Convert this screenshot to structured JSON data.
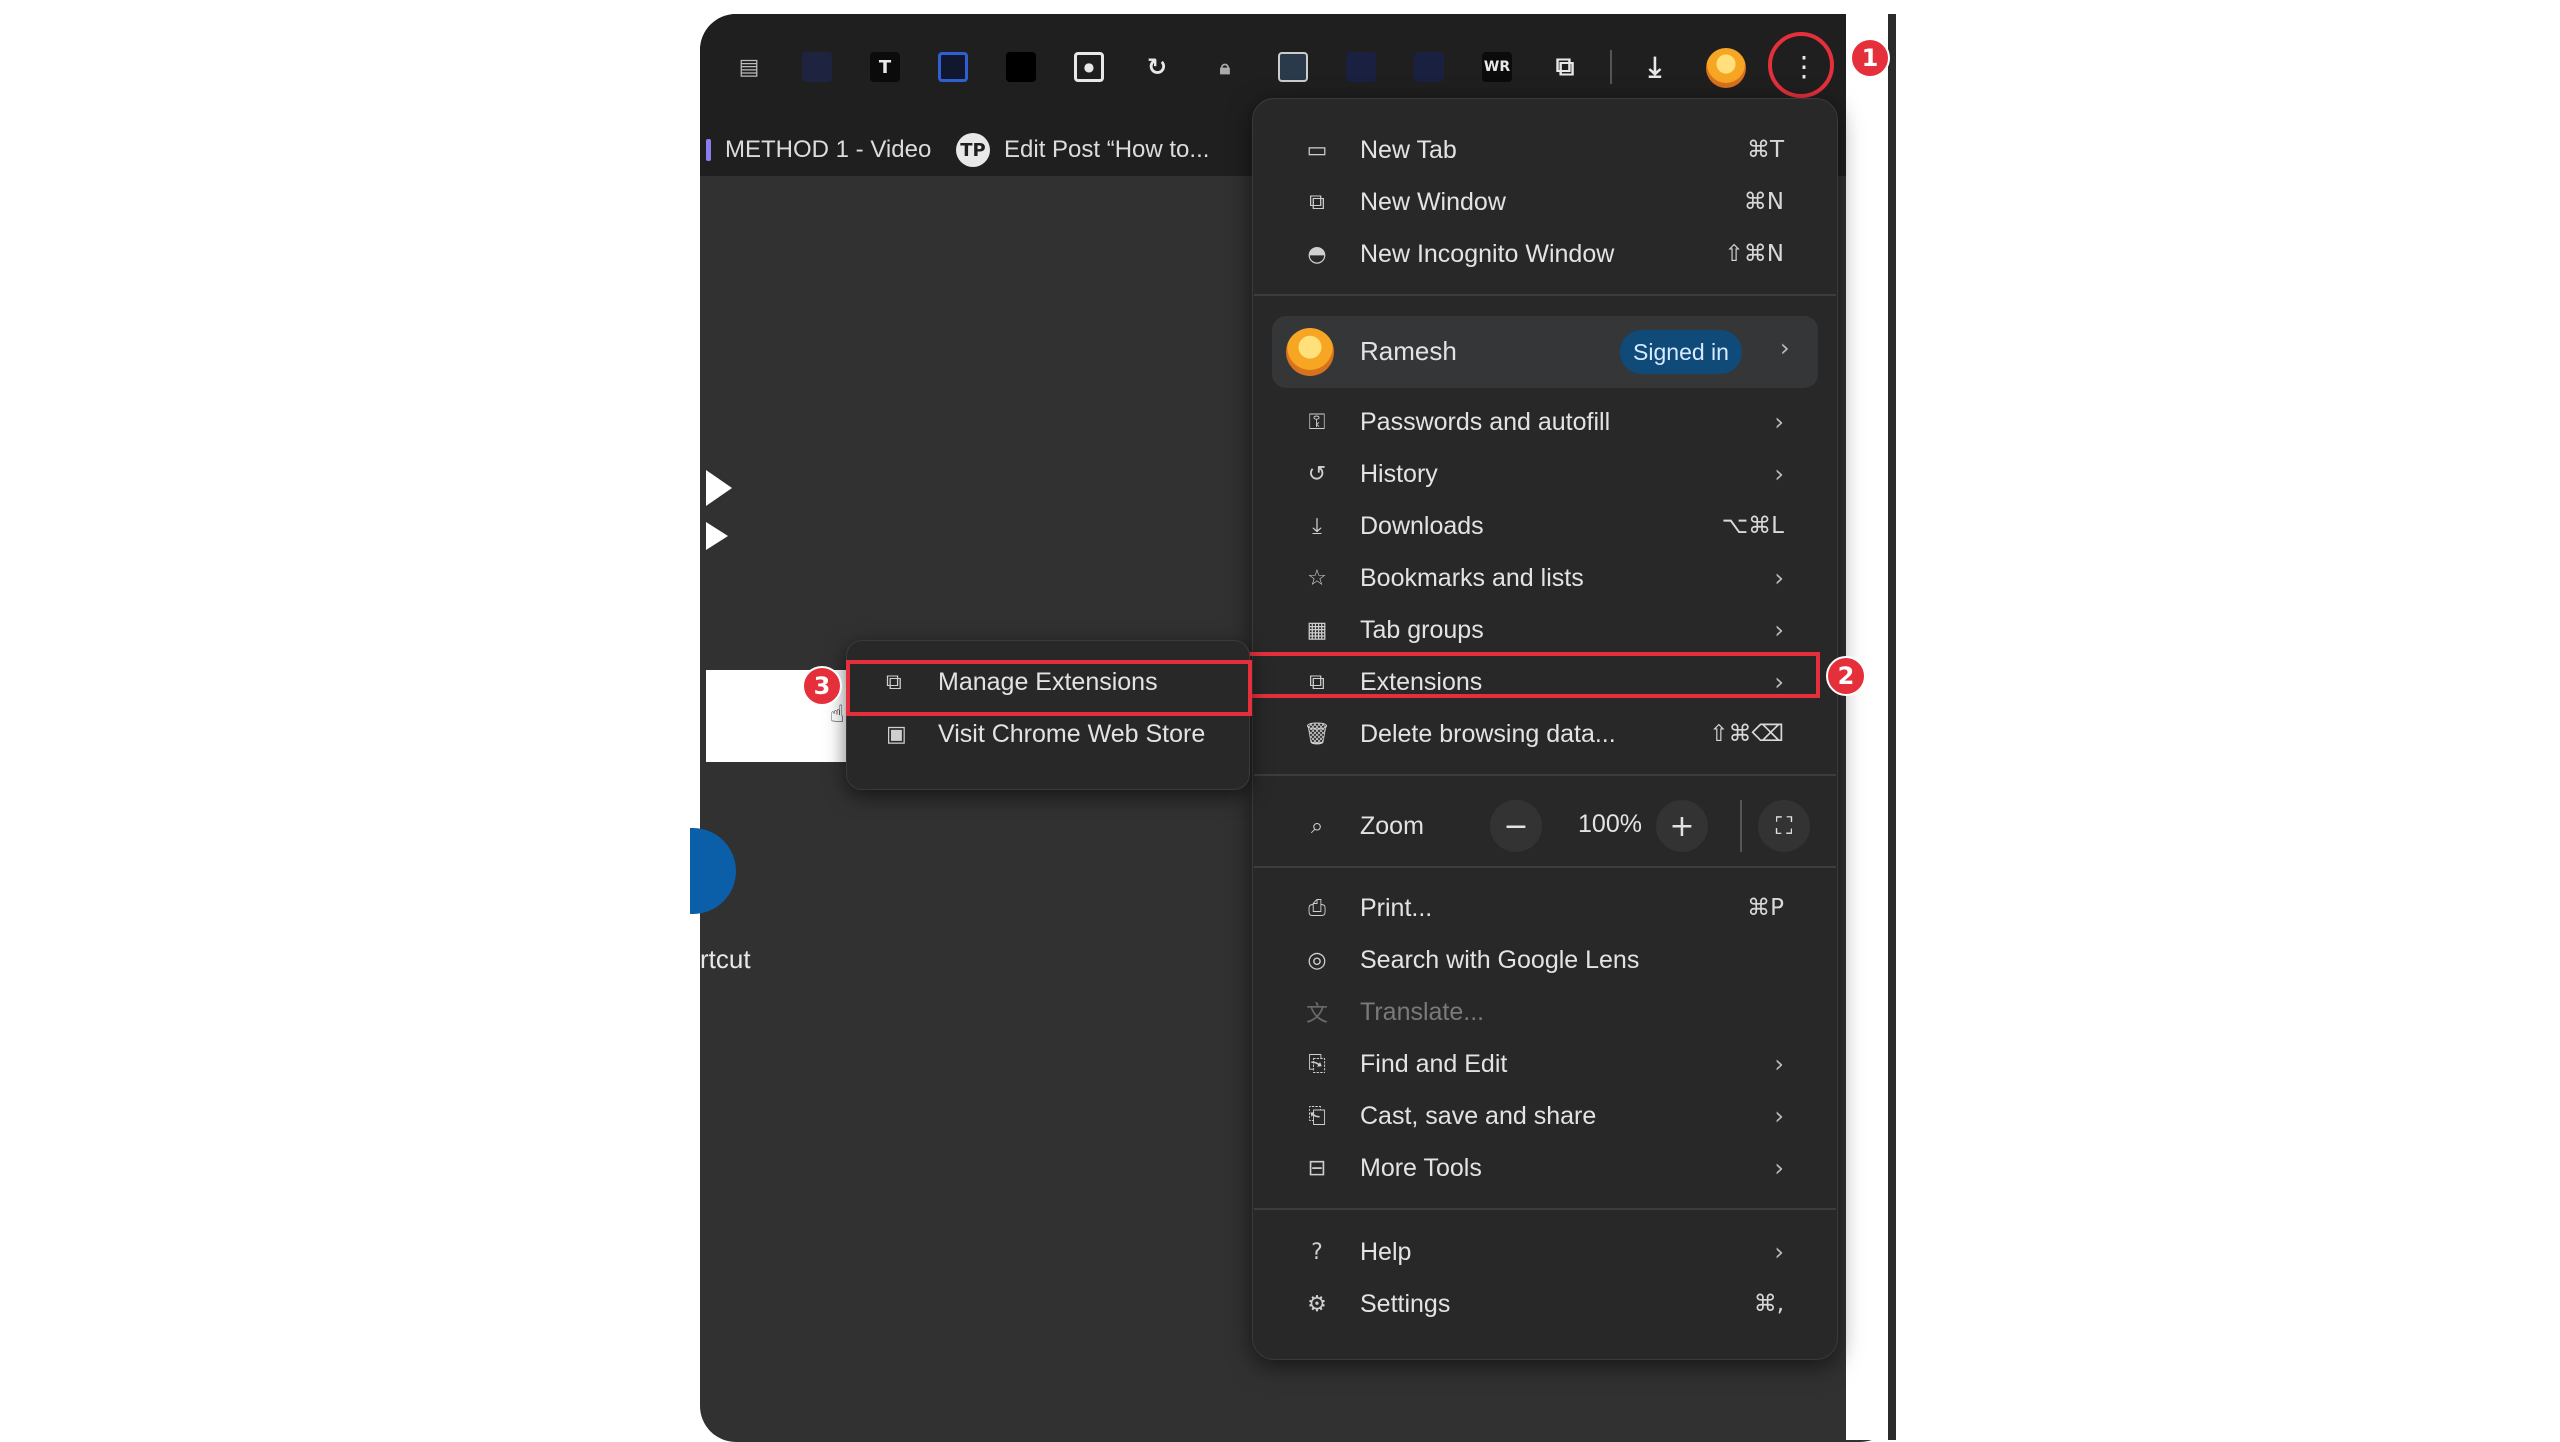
{
  "toolbar": {
    "extension_icons": [
      "notes-icon",
      "dark-square-icon",
      "T",
      "blue-square-icon",
      "black-square-icon",
      "square-dot-icon",
      "refresh-icon",
      "lock-icon",
      "image-icon",
      "navy-square-icon",
      "navy-square-icon-2",
      "WR"
    ],
    "puzzle_icon": "extensions-icon",
    "download_icon": "download-icon",
    "menu_icon": "more-vert-icon"
  },
  "bookmarks": [
    {
      "label": "METHOD 1 - Video"
    },
    {
      "label": "Edit Post “How to...",
      "logo": "TP"
    }
  ],
  "background": {
    "partial_text": "rtcut"
  },
  "menu": {
    "group1": [
      {
        "label": "New Tab",
        "shortcut": "⌘T"
      },
      {
        "label": "New Window",
        "shortcut": "⌘N"
      },
      {
        "label": "New Incognito Window",
        "shortcut": "⇧⌘N"
      }
    ],
    "profile": {
      "name": "Ramesh",
      "status": "Signed in"
    },
    "group2": [
      {
        "label": "Passwords and autofill",
        "has_submenu": true
      },
      {
        "label": "History",
        "has_submenu": true
      },
      {
        "label": "Downloads",
        "shortcut": "⌥⌘L"
      },
      {
        "label": "Bookmarks and lists",
        "has_submenu": true
      },
      {
        "label": "Tab groups",
        "has_submenu": true
      },
      {
        "label": "Extensions",
        "has_submenu": true
      },
      {
        "label": "Delete browsing data...",
        "shortcut": "⇧⌘⌫"
      }
    ],
    "zoom": {
      "label": "Zoom",
      "value": "100%",
      "minus": "−",
      "plus": "+"
    },
    "group3": [
      {
        "label": "Print...",
        "shortcut": "⌘P"
      },
      {
        "label": "Search with Google Lens"
      },
      {
        "label": "Translate..."
      },
      {
        "label": "Find and Edit",
        "has_submenu": true
      },
      {
        "label": "Cast, save and share",
        "has_submenu": true
      },
      {
        "label": "More Tools",
        "has_submenu": true
      }
    ],
    "group4": [
      {
        "label": "Help",
        "has_submenu": true
      },
      {
        "label": "Settings",
        "shortcut": "⌘,"
      }
    ]
  },
  "submenu": [
    {
      "label": "Manage Extensions"
    },
    {
      "label": "Visit Chrome Web Store"
    }
  ],
  "annotations": [
    "1",
    "2",
    "3"
  ],
  "colors": {
    "highlight": "#e5303c",
    "menu_bg": "#282828",
    "badge_bg": "#0f4a78"
  }
}
